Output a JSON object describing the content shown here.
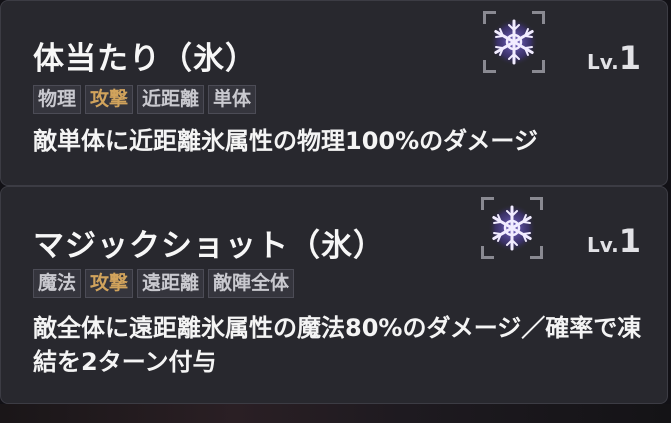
{
  "skills": [
    {
      "name": "体当たり（氷）",
      "tags": [
        {
          "label": "物理",
          "kind": "normal"
        },
        {
          "label": "攻撃",
          "kind": "attack"
        },
        {
          "label": "近距離",
          "kind": "normal"
        },
        {
          "label": "単体",
          "kind": "normal"
        }
      ],
      "description": "敵単体に近距離氷属性の物理100%のダメージ",
      "level_label": "Lv.",
      "level_value": "1",
      "icon": "ice-snowflake-icon"
    },
    {
      "name": "マジックショット（氷）",
      "tags": [
        {
          "label": "魔法",
          "kind": "normal"
        },
        {
          "label": "攻撃",
          "kind": "attack"
        },
        {
          "label": "遠距離",
          "kind": "normal"
        },
        {
          "label": "敵陣全体",
          "kind": "normal"
        }
      ],
      "description": "敵全体に遠距離氷属性の魔法80%のダメージ／確率で凍結を2ターン付与",
      "level_label": "Lv.",
      "level_value": "1",
      "icon": "ice-snowflake-icon"
    }
  ],
  "colors": {
    "card_bg": "#28282e",
    "tag_attack": "#d1a35c",
    "tag_normal": "#c9c9cf",
    "icon_snowflake": "#e9e2ff",
    "icon_glow": "#6a56c8"
  }
}
